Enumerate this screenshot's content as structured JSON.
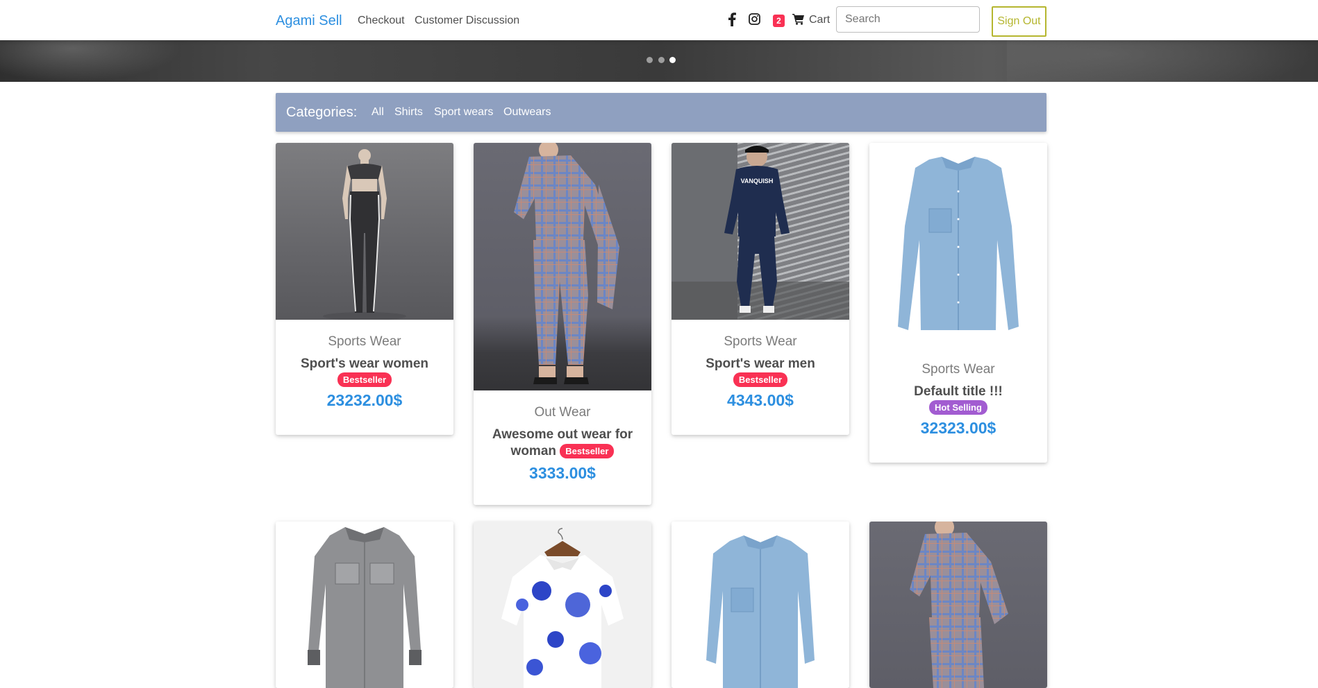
{
  "navbar": {
    "brand": "Agami Sell",
    "links": [
      "Checkout",
      "Customer Discussion"
    ],
    "cart_count": "2",
    "cart_label": "Cart",
    "search_placeholder": "Search",
    "signout_label": "Sign Out"
  },
  "carousel": {
    "slides": 3,
    "active_index": 2
  },
  "categories": {
    "title": "Categories:",
    "items": [
      "All",
      "Shirts",
      "Sport wears",
      "Outwears"
    ]
  },
  "products": [
    {
      "category": "Sports Wear",
      "title": "Sport's wear women",
      "badge": "Bestseller",
      "price": "23232.00$"
    },
    {
      "category": "Out Wear",
      "title": "Awesome out wear for woman",
      "badge": "Bestseller",
      "price": "3333.00$"
    },
    {
      "category": "Sports Wear",
      "title": "Sport's wear men",
      "badge": "Bestseller",
      "price": "4343.00$"
    },
    {
      "category": "Sports Wear",
      "title": "Default title !!!",
      "badge": "Hot Selling",
      "price": "32323.00$"
    }
  ],
  "second_row_images": [
    "grey-denim-shirt",
    "floral-print-shirt",
    "light-blue-denim-shirt",
    "plaid-outfit"
  ],
  "colors": {
    "brand": "#2d8fe0",
    "category_bar": "#8fa0c0",
    "badge_red": "#f93154",
    "badge_purple": "#a25cd1",
    "signout": "#b5b62f"
  }
}
